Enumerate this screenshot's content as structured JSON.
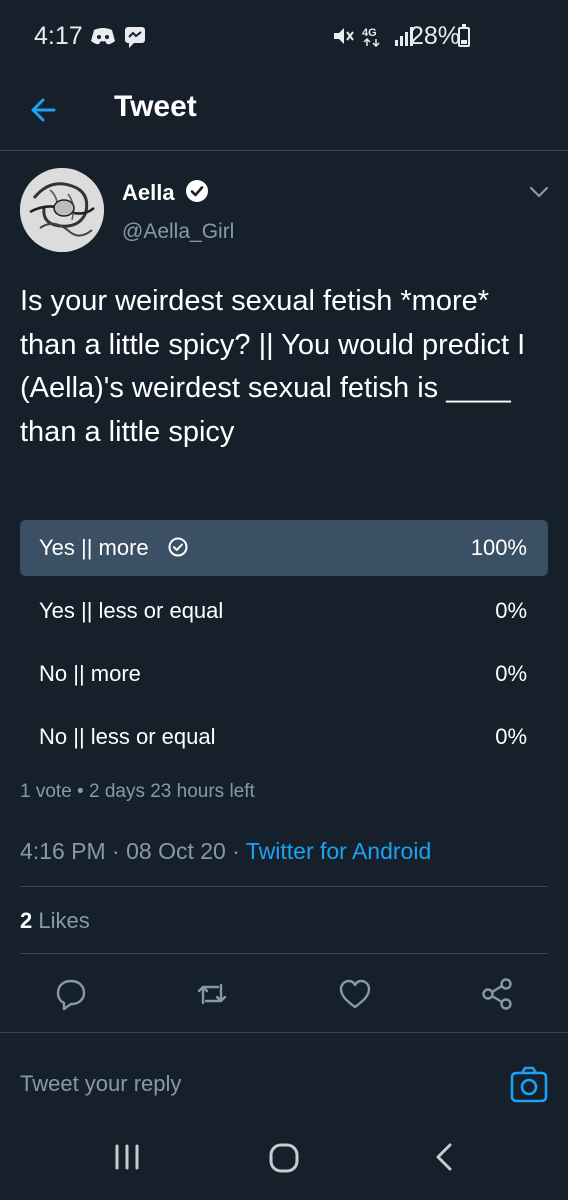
{
  "status_bar": {
    "time": "4:17",
    "battery": "28%",
    "battery_level": 0.28
  },
  "header": {
    "title": "Tweet"
  },
  "tweet": {
    "author_name": "Aella",
    "handle": "@Aella_Girl",
    "text": "Is your weirdest sexual fetish *more* than a little spicy? || You would predict I (Aella)'s weirdest sexual fetish is ____ than a little spicy",
    "poll": {
      "options": [
        {
          "label": "Yes || more",
          "percent": "100%",
          "selected": true
        },
        {
          "label": "Yes || less or equal",
          "percent": "0%"
        },
        {
          "label": "No || more",
          "percent": "0%"
        },
        {
          "label": "No || less or equal",
          "percent": "0%"
        }
      ],
      "meta": "1 vote • 2 days 23 hours left"
    },
    "time": "4:16 PM",
    "date": "08 Oct 20",
    "client": "Twitter for Android",
    "likes_count": "2",
    "likes_label": "Likes"
  },
  "actions": {
    "reply_icon": "reply-icon",
    "retweet_icon": "retweet-icon",
    "like_icon": "heart-icon",
    "share_icon": "share-icon"
  },
  "reply": {
    "placeholder": "Tweet your reply"
  },
  "colors": {
    "accent": "#1da1f2",
    "background": "#15202b",
    "poll_winner": "#3b5064",
    "muted": "#8899a6"
  }
}
